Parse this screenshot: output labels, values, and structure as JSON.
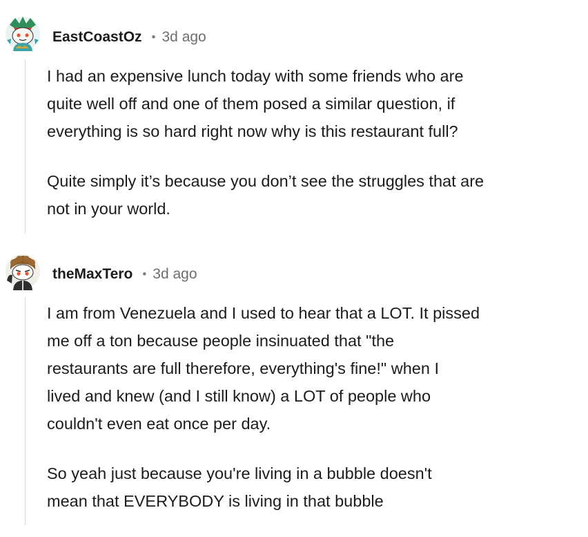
{
  "comments": [
    {
      "username": "EastCoastOz",
      "separator": "•",
      "timestamp": "3d ago",
      "avatar_icon": "snoo-avatar-icon",
      "paragraphs": [
        "I had an expensive lunch today with some friends who are\nquite well off and one of them posed a similar question, if\neverything is so hard right now why is this restaurant full?",
        "Quite simply it’s because you don’t see the struggles that are\nnot in your world."
      ]
    },
    {
      "username": "theMaxTero",
      "separator": "•",
      "timestamp": "3d ago",
      "avatar_icon": "snoo-avatar-icon",
      "paragraphs": [
        "I am from Venezuela and I used to hear that a LOT. It pissed\nme off a ton because people insinuated that \"the\nrestaurants are full therefore, everything's fine!\" when I\nlived and knew (and I still know) a LOT of people who\ncouldn't even eat once per day.",
        "So yeah just because you're living in a bubble doesn't\nmean that EVERYBODY is living in that bubble"
      ]
    }
  ],
  "colors": {
    "thread_line": "#d6d6d6",
    "username": "#1c1c1c",
    "timestamp": "#6b6f72"
  }
}
